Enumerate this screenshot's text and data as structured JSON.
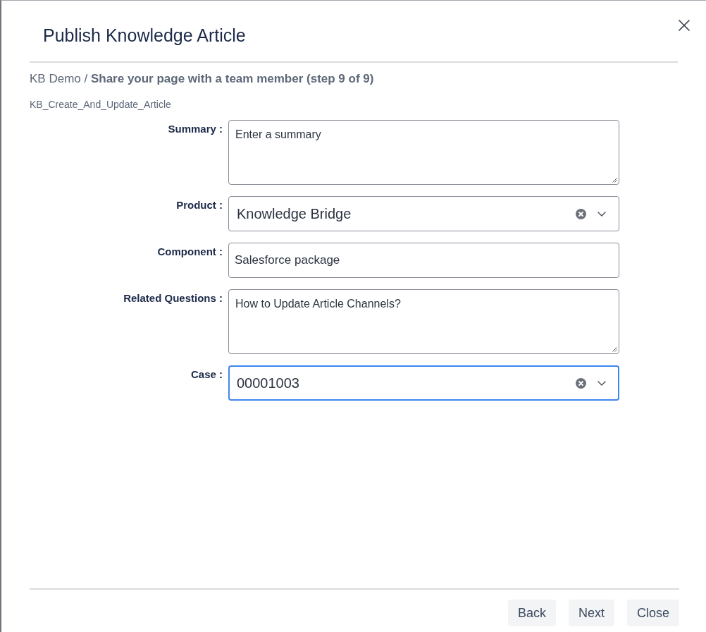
{
  "dialog": {
    "title": "Publish Knowledge Article"
  },
  "breadcrumb": "KB Demo / **Share your page with a team member (step 9 of 9)**",
  "subtitle": "KB_Create_And_Update_Article",
  "fields": [
    {
      "kind": "textarea",
      "label": "Summary :",
      "value": "Enter a summary",
      "focused": false
    },
    {
      "kind": "select",
      "label": "Product :",
      "value": "Knowledge Bridge",
      "focused": false
    },
    {
      "kind": "input",
      "label": "Component :",
      "value": "Salesforce package",
      "focused": false
    },
    {
      "kind": "textarea",
      "label": "Related Questions :",
      "value": "How to Update Article Channels?",
      "focused": false
    },
    {
      "kind": "select",
      "label": "Case :",
      "value": "00001003",
      "focused": true
    }
  ],
  "buttons": [
    "Back",
    "Next",
    "Close"
  ]
}
